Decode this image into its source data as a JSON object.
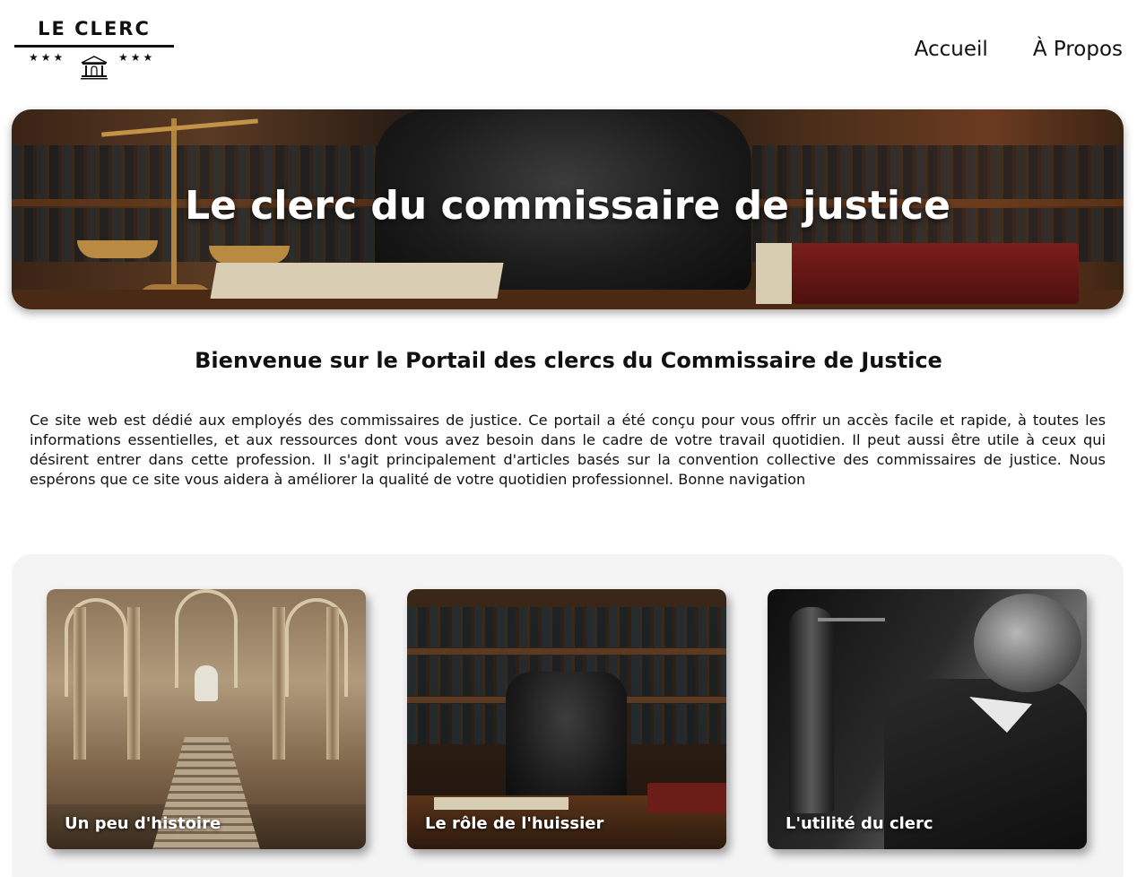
{
  "header": {
    "logo_text": "LE CLERC",
    "logo_stars_left": "★★★",
    "logo_stars_right": "★★★",
    "nav": [
      {
        "label": "Accueil"
      },
      {
        "label": "À Propos"
      }
    ]
  },
  "hero": {
    "title": "Le clerc du commissaire de justice"
  },
  "welcome": {
    "title": "Bienvenue sur le Portail des clercs du Commissaire de Justice",
    "paragraph": "Ce site web est dédié aux employés des commissaires de justice. Ce portail a été conçu pour vous offrir un accès facile et rapide, à toutes les informations essentielles, et aux ressources dont vous avez besoin dans le cadre de votre travail quotidien. Il peut aussi être utile à ceux qui désirent entrer dans cette profession. Il s'agit principalement d'articles basés sur la convention collective des commissaires de justice. Nous espérons que ce site vous aidera à améliorer la qualité de votre quotidien professionnel. Bonne navigation"
  },
  "cards": [
    {
      "label": "Un peu d'histoire"
    },
    {
      "label": "Le rôle de l'huissier"
    },
    {
      "label": "L'utilité du clerc"
    }
  ]
}
